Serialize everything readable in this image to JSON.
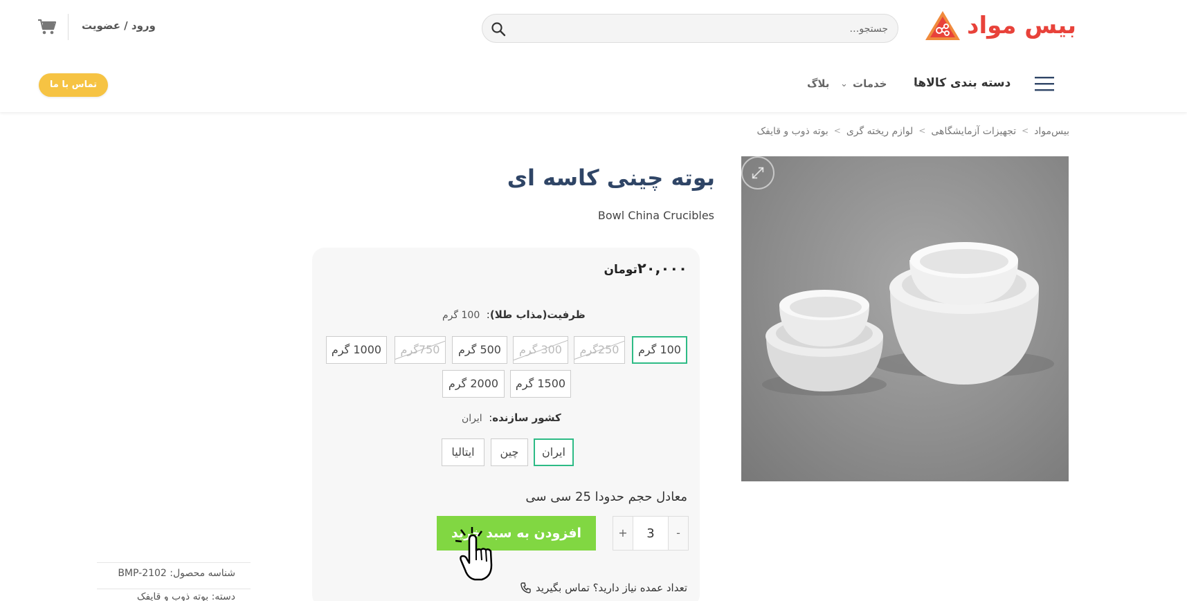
{
  "header": {
    "logo_text": "بیس مواد",
    "search_placeholder": "جستجو…",
    "login_label": "ورود / عضویت"
  },
  "nav": {
    "categories_label": "دسته بندی کالاها",
    "services_label": "خدمات",
    "blog_label": "بلاگ",
    "contact_label": "تماس با ما"
  },
  "breadcrumb": [
    "بیس‌مواد",
    "تجهیزات آزمایشگاهی",
    "لوازم ریخته گری",
    "بوته ذوب و قایفک"
  ],
  "product": {
    "title": "بوته چینی کاسه ای",
    "subtitle": "Bowl China Crucibles",
    "price": "۲۰,۰۰۰",
    "currency": "تومان",
    "capacity_label": "ظرفیت(مذاب طلا)",
    "capacity_selected": "100 گرم",
    "capacity_options": [
      {
        "label": "100 گرم",
        "state": "selected"
      },
      {
        "label": "250گرم",
        "state": "disabled"
      },
      {
        "label": "300 گرم",
        "state": "disabled"
      },
      {
        "label": "500 گرم",
        "state": "available"
      },
      {
        "label": "750گرم",
        "state": "disabled"
      },
      {
        "label": "1000 گرم",
        "state": "available"
      },
      {
        "label": "1500 گرم",
        "state": "available"
      },
      {
        "label": "2000 گرم",
        "state": "available"
      }
    ],
    "country_label": "کشور سازنده",
    "country_selected": "ایران",
    "country_options": [
      {
        "label": "ایران",
        "state": "selected"
      },
      {
        "label": "چین",
        "state": "available"
      },
      {
        "label": "ایتالیا",
        "state": "available"
      }
    ],
    "volume_note": "معادل حجم حدودا 25 سی سی",
    "quantity": "3",
    "qty_plus": "+",
    "qty_minus": "-",
    "add_to_cart_label": "افزودن به سبد خرید",
    "bulk_contact": "تعداد عمده نیاز دارید؟ تماس بگیرید",
    "sku_label": "شناسه محصول:",
    "sku_value": "BMP-2102",
    "category_partial": "دسته: بوته ذوب و قایفک"
  },
  "colors": {
    "brand_red": "#e8423a",
    "title_blue": "#2f4566",
    "cta_green": "#81d742",
    "selected_border": "#2dbb85",
    "contact_yellow": "#f6c343"
  },
  "icons": [
    "cart-icon",
    "search-icon",
    "hamburger-icon",
    "chevron-down-icon",
    "zoom-icon",
    "phone-icon",
    "hand-cursor-icon"
  ]
}
